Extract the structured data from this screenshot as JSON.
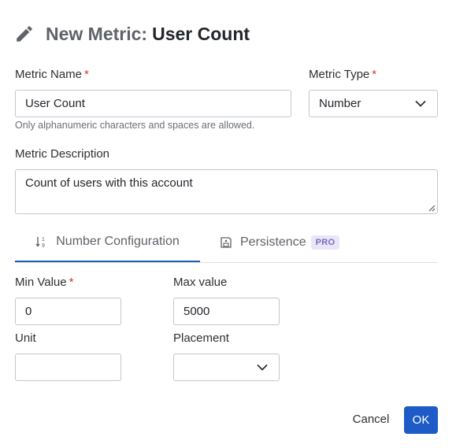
{
  "header": {
    "icon": "pencil-icon",
    "prefix": "New Metric:",
    "metric_name": "User Count"
  },
  "form": {
    "metric_name": {
      "label": "Metric Name",
      "required_mark": "*",
      "value": "User Count",
      "hint": "Only alphanumeric characters and spaces are allowed."
    },
    "metric_type": {
      "label": "Metric Type",
      "required_mark": "*",
      "selected": "Number"
    },
    "metric_description": {
      "label": "Metric Description",
      "value": "Count of users with this account"
    }
  },
  "tabs": [
    {
      "label": "Number Configuration",
      "icon": "sort-numeric-icon",
      "active": true
    },
    {
      "label": "Persistence",
      "icon": "save-icon",
      "badge": "PRO",
      "active": false
    }
  ],
  "number_config": {
    "min_value": {
      "label": "Min Value",
      "required_mark": "*",
      "value": "0"
    },
    "max_value": {
      "label": "Max value",
      "value": "5000"
    },
    "unit": {
      "label": "Unit",
      "value": ""
    },
    "placement": {
      "label": "Placement",
      "selected": ""
    }
  },
  "actions": {
    "cancel_label": "Cancel",
    "ok_label": "OK"
  },
  "colors": {
    "primary": "#1e5bc6",
    "required": "#d0363a",
    "pro_badge_bg": "#ebe6f7",
    "pro_badge_text": "#7b6cc0"
  }
}
